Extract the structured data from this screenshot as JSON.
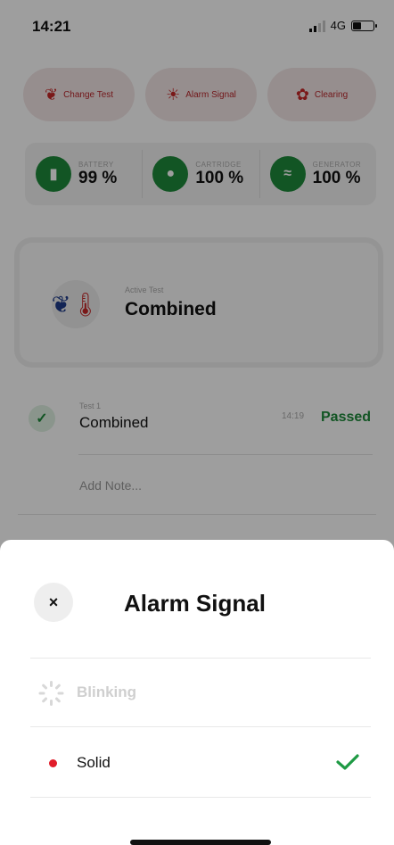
{
  "status_bar": {
    "time": "14:21",
    "network": "4G"
  },
  "actions": {
    "change_test": "Change Test",
    "alarm_signal": "Alarm Signal",
    "clearing": "Clearing"
  },
  "stats": {
    "battery": {
      "label": "BATTERY",
      "value": "99 %"
    },
    "cartridge": {
      "label": "CARTRIDGE",
      "value": "100 %"
    },
    "generator": {
      "label": "GENERATOR",
      "value": "100 %"
    }
  },
  "active_test": {
    "label": "Active Test",
    "name": "Combined"
  },
  "test_row": {
    "number": "Test 1",
    "name": "Combined",
    "time": "14:19",
    "status": "Passed"
  },
  "add_note": "Add Note...",
  "sheet": {
    "title": "Alarm Signal",
    "close_glyph": "×",
    "options": [
      {
        "label": "Blinking",
        "enabled": false,
        "selected": false
      },
      {
        "label": "Solid",
        "enabled": true,
        "selected": true
      }
    ]
  },
  "colors": {
    "accent_red": "#e11d2a",
    "status_green": "#1e8a3a",
    "check_green": "#1e9a44"
  }
}
